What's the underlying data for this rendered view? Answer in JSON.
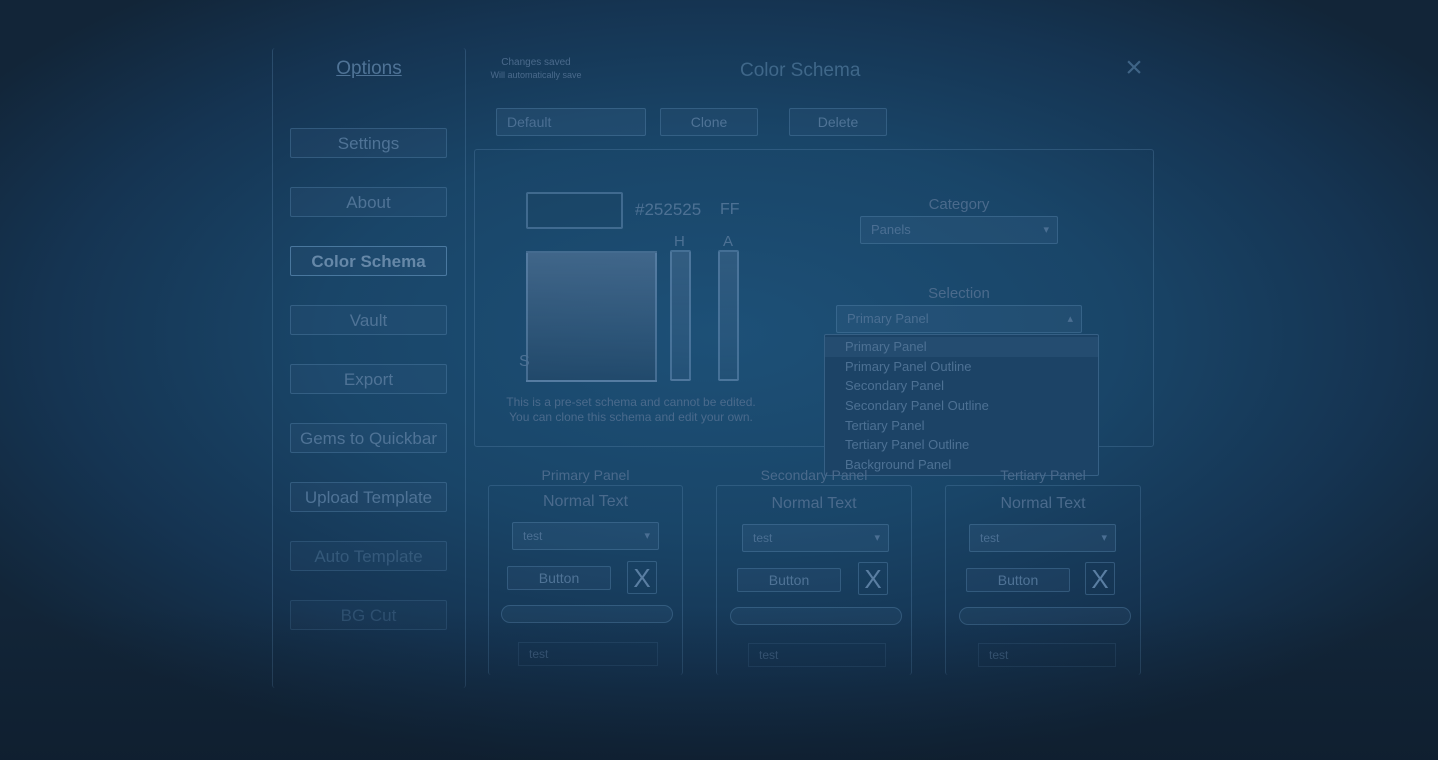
{
  "options": {
    "title": "Options",
    "menu": [
      "Settings",
      "About",
      "Color Schema",
      "Vault",
      "Export",
      "Gems to Quickbar",
      "Upload Template",
      "Auto Template",
      "BG Cut"
    ]
  },
  "header": {
    "status_line1": "Changes saved",
    "status_line2": "Will automatically save",
    "title": "Color Schema",
    "close": "×"
  },
  "toolbar": {
    "schema_value": "Default",
    "clone_label": "Clone",
    "delete_label": "Delete"
  },
  "picker": {
    "hex": "#252525",
    "alpha_hex": "FF",
    "hue_label": "H",
    "alpha_label": "A",
    "sv_label": "S",
    "note_line1": "This is a pre-set schema and cannot be edited.",
    "note_line2": "You can clone this schema and edit your own."
  },
  "category": {
    "label": "Category",
    "value": "Panels"
  },
  "selection": {
    "label": "Selection",
    "value": "Primary Panel",
    "options": [
      "Primary Panel",
      "Primary Panel Outline",
      "Secondary Panel",
      "Secondary Panel Outline",
      "Tertiary Panel",
      "Tertiary Panel Outline",
      "Background Panel"
    ]
  },
  "previews": [
    {
      "title": "Primary Panel",
      "text": "Normal Text",
      "dropdown": "test",
      "button": "Button",
      "x": "X",
      "input": "test"
    },
    {
      "title": "Secondary Panel",
      "text": "Normal Text",
      "dropdown": "test",
      "button": "Button",
      "x": "X",
      "input": "test"
    },
    {
      "title": "Tertiary Panel",
      "text": "Normal Text",
      "dropdown": "test",
      "button": "Button",
      "x": "X",
      "input": "test"
    }
  ],
  "colors": {
    "background": "#1a4a6e",
    "panel_outline": "#5f8cb4",
    "text": "#4f7396"
  }
}
